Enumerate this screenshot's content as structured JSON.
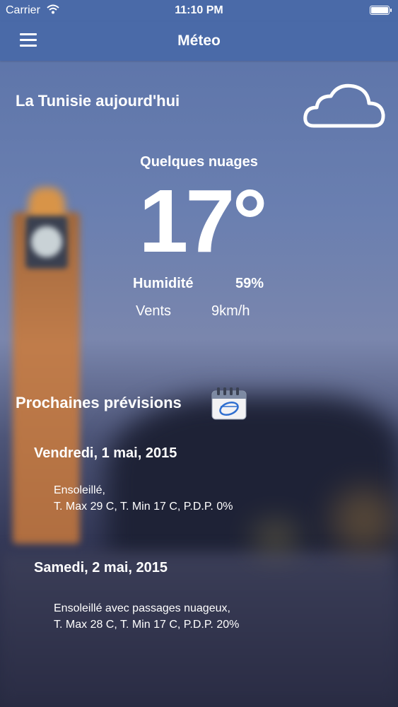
{
  "statusbar": {
    "carrier": "Carrier",
    "time": "11:10 PM",
    "battery_level": 1.0
  },
  "navbar": {
    "title": "Méteo"
  },
  "today": {
    "title": "La Tunisie aujourd'hui",
    "condition": "Quelques nuages",
    "temperature": "17°",
    "humidity_label": "Humidité",
    "humidity_value": "59%",
    "wind_label": "Vents",
    "wind_value": "9km/h",
    "icon": "cloud-icon"
  },
  "forecast": {
    "title": "Prochaines prévisions",
    "icon": "calendar-icon",
    "days": [
      {
        "date": "Vendredi, 1 mai, 2015",
        "summary": "Ensoleillé,",
        "details": "T. Max 29 C, T. Min 17 C, P.D.P. 0%"
      },
      {
        "date": "Samedi, 2 mai, 2015",
        "summary": "Ensoleillé avec passages nuageux,",
        "details": "T. Max 28 C, T. Min 17 C, P.D.P. 20%"
      }
    ]
  },
  "colors": {
    "navbar": "#4a6aa8",
    "text": "#ffffff"
  }
}
